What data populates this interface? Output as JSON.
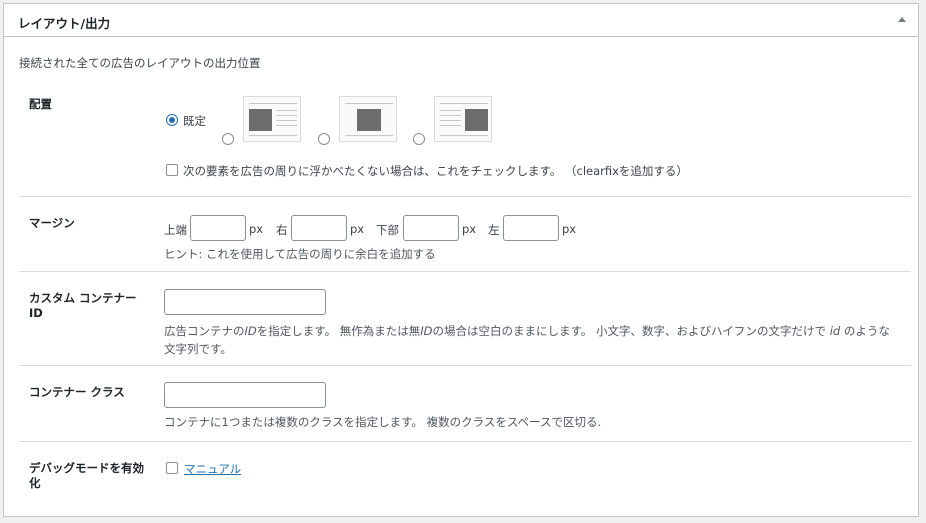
{
  "panel": {
    "title": "レイアウト/出力",
    "description": "接続された全ての広告のレイアウトの出力位置"
  },
  "placement": {
    "label": "配置",
    "default_option": "既定",
    "clearfix_text": "次の要素を広告の周りに浮かべたくない場合は、これをチェックします。 （clearfixを追加する）"
  },
  "margin": {
    "label": "マージン",
    "top": "上端",
    "right": "右",
    "bottom": "下部",
    "left": "左",
    "unit": "px",
    "hint": "ヒント: これを使用して広告の周りに余白を追加する"
  },
  "container_id": {
    "label_line1": "カスタム コンテナー",
    "label_line2": "ID",
    "hint_line1a": "広告コンテナの",
    "hint_id1": "ID",
    "hint_line1b": "を指定します。 無作為または無",
    "hint_id2": "ID",
    "hint_line1c": "の場合は空白のままにします。 小文字、数字、およびハイフンの文字だけで ",
    "hint_id3": "id",
    "hint_line1d": " のような",
    "hint_line2": "文字列です。"
  },
  "container_class": {
    "label": "コンテナー クラス",
    "hint": "コンテナに1つまたは複数のクラスを指定します。 複数のクラスをスペースで区切る."
  },
  "debug": {
    "label_line1": "デバッグモードを有効",
    "label_line2": "化",
    "link": "マニュアル"
  },
  "colors": {
    "accent": "#2271b1",
    "border": "#c3c4c7"
  }
}
